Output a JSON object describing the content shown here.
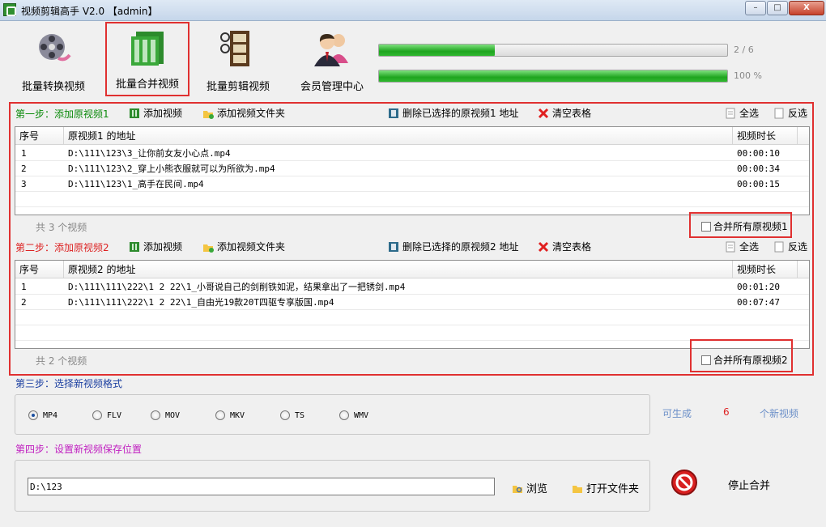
{
  "window": {
    "title": "视频剪辑高手 V2.0  【admin】",
    "min": "–",
    "max": "□",
    "close": "X"
  },
  "toolbar": [
    {
      "label": "批量转换视频"
    },
    {
      "label": "批量合并视频"
    },
    {
      "label": "批量剪辑视频"
    },
    {
      "label": "会员管理中心"
    }
  ],
  "progress": [
    {
      "text": "2 / 6",
      "fraction": 0.333
    },
    {
      "text": "100 %",
      "fraction": 1.0
    }
  ],
  "step1": {
    "title": "第一步：添加原视频1",
    "add_video": "添加视频",
    "add_folder": "添加视频文件夹",
    "delete_selected": "删除已选择的原视频1 地址",
    "clear": "清空表格",
    "select_all": "全选",
    "invert": "反选",
    "columns": [
      "序号",
      "原视频1 的地址",
      "视频时长"
    ],
    "rows": [
      {
        "no": "1",
        "path": "D:\\111\\123\\3_让你前女友小心点.mp4",
        "duration": "00:00:10"
      },
      {
        "no": "2",
        "path": "D:\\111\\123\\2_穿上小熊衣服就可以为所欲为.mp4",
        "duration": "00:00:34"
      },
      {
        "no": "3",
        "path": "D:\\111\\123\\1_高手在民间.mp4",
        "duration": "00:00:15"
      }
    ],
    "count": "共 3 个视频",
    "merge_all": "合并所有原视频1"
  },
  "step2": {
    "title": "第二步：添加原视频2",
    "add_video": "添加视频",
    "add_folder": "添加视频文件夹",
    "delete_selected": "删除已选择的原视频2 地址",
    "clear": "清空表格",
    "select_all": "全选",
    "invert": "反选",
    "columns": [
      "序号",
      "原视频2 的地址",
      "视频时长"
    ],
    "rows": [
      {
        "no": "1",
        "path": "D:\\111\\111\\222\\1 2  22\\1_小哥说自己的剑削铁如泥，结果拿出了一把锈剑.mp4",
        "duration": "00:01:20"
      },
      {
        "no": "2",
        "path": "D:\\111\\111\\222\\1 2  22\\1_自由光19款20T四驱专享版国.mp4",
        "duration": "00:07:47"
      }
    ],
    "count": "共 2 个视频",
    "merge_all": "合并所有原视频2"
  },
  "step3": {
    "title": "第三步：选择新视频格式",
    "formats": [
      "MP4",
      "FLV",
      "MOV",
      "MKV",
      "TS",
      "WMV"
    ],
    "selected": "MP4",
    "gen_prefix": "可生成",
    "gen_count": "6",
    "gen_suffix": "个新视频"
  },
  "step4": {
    "title": "第四步：设置新视频保存位置",
    "path": "D:\\123",
    "browse": "浏览",
    "open_folder": "打开文件夹",
    "stop": "停止合并"
  },
  "colors": {
    "accent_red": "#e03030",
    "progress_green": "#1fa51f"
  }
}
